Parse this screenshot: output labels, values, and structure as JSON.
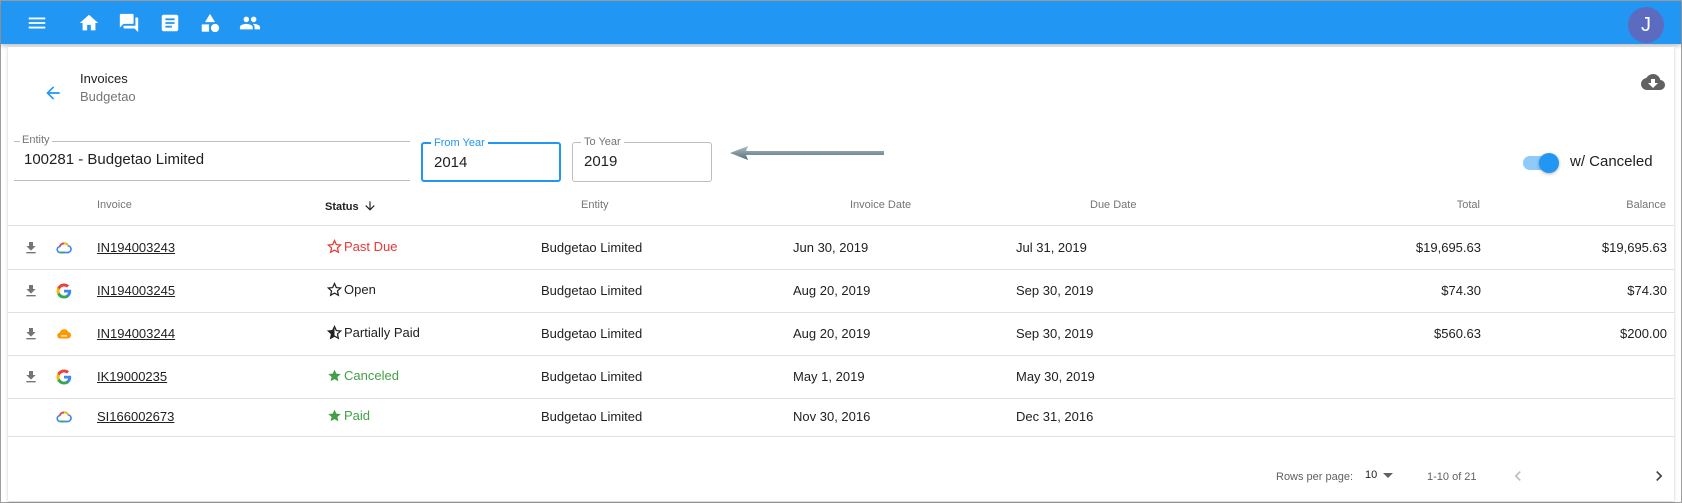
{
  "appbar": {
    "color": "#2196f3",
    "icons": [
      "menu-icon",
      "home-icon",
      "forum-icon",
      "article-icon",
      "category-icon",
      "people-icon"
    ],
    "avatar_letter": "J"
  },
  "header": {
    "title": "Invoices",
    "subtitle": "Budgetao"
  },
  "filters": {
    "entity": {
      "label": "Entity",
      "value": "100281 - Budgetao Limited"
    },
    "from_year": {
      "label": "From Year",
      "value": "2014"
    },
    "to_year": {
      "label": "To Year",
      "value": "2019"
    },
    "canceled_toggle": {
      "label": "w/ Canceled",
      "checked": true
    }
  },
  "table": {
    "columns": {
      "invoice": "Invoice",
      "status": "Status",
      "entity": "Entity",
      "invoice_date": "Invoice Date",
      "due_date": "Due Date",
      "total": "Total",
      "balance": "Balance"
    },
    "rows": [
      {
        "download": true,
        "source_icon": "cloud-multicolor-icon",
        "invoice": "IN194003243",
        "status": "Past Due",
        "status_icon": "star-outline-icon",
        "status_color": "#e53935",
        "entity": "Budgetao Limited",
        "invoice_date": "Jun 30, 2019",
        "due_date": "Jul 31, 2019",
        "total": "$19,695.63",
        "balance": "$19,695.63"
      },
      {
        "download": true,
        "source_icon": "google-g-icon",
        "invoice": "IN194003245",
        "status": "Open",
        "status_icon": "star-outline-icon",
        "status_color": "#212121",
        "entity": "Budgetao Limited",
        "invoice_date": "Aug 20, 2019",
        "due_date": "Sep 30, 2019",
        "total": "$74.30",
        "balance": "$74.30"
      },
      {
        "download": true,
        "source_icon": "cloud-orange-icon",
        "invoice": "IN194003244",
        "status": "Partially Paid",
        "status_icon": "star-half-icon",
        "status_color": "#212121",
        "entity": "Budgetao Limited",
        "invoice_date": "Aug 20, 2019",
        "due_date": "Sep 30, 2019",
        "total": "$560.63",
        "balance": "$200.00"
      },
      {
        "download": true,
        "source_icon": "google-g-icon",
        "invoice": "IK19000235",
        "status": "Canceled",
        "status_icon": "star-filled-icon",
        "status_color": "#43a047",
        "entity": "Budgetao Limited",
        "invoice_date": "May 1, 2019",
        "due_date": "May 30, 2019",
        "total": "",
        "balance": ""
      },
      {
        "download": false,
        "source_icon": "cloud-multicolor-icon",
        "invoice": "SI166002673",
        "status": "Paid",
        "status_icon": "star-filled-icon",
        "status_color": "#43a047",
        "entity": "Budgetao Limited",
        "invoice_date": "Nov 30, 2016",
        "due_date": "Dec 31, 2016",
        "total": "",
        "balance": ""
      }
    ]
  },
  "pagination": {
    "rows_per_page_label": "Rows per page:",
    "rows_per_page": "10",
    "range": "1-10 of 21"
  }
}
